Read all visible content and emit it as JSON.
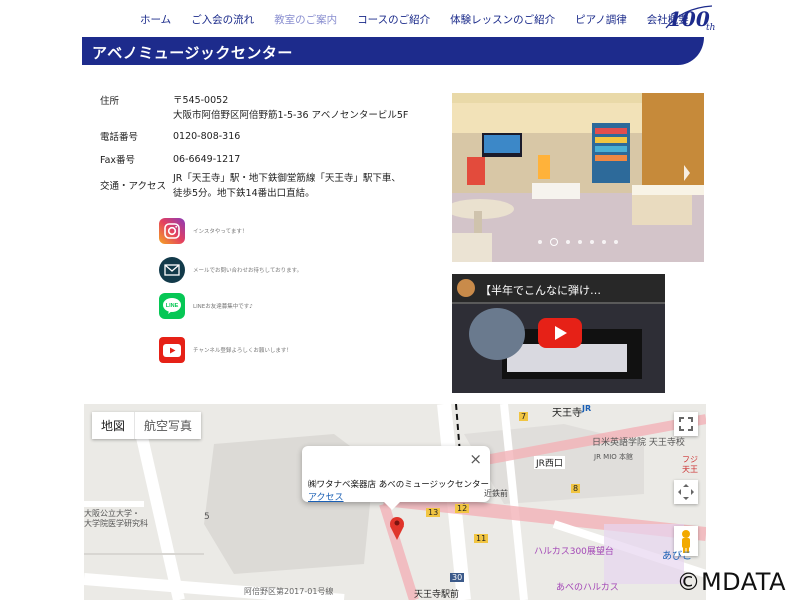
{
  "nav": {
    "items": [
      "ホーム",
      "ご入会の流れ",
      "教室のご案内",
      "コースのご紹介",
      "体験レッスンのご紹介",
      "ピアノ調律",
      "会社概要"
    ],
    "active_index": 2,
    "logo_text": "100th"
  },
  "page_title": "アベノミュージックセンター",
  "info": {
    "address_label": "住所",
    "postal": "〒545-0052",
    "address": "大阪市阿倍野区阿倍野筋1-5-36 アベノセンタービル5F",
    "phone_label": "電話番号",
    "phone": "0120-808-316",
    "fax_label": "Fax番号",
    "fax": "06-6649-1217",
    "access_label": "交通・アクセス",
    "access": "JR「天王寺」駅・地下鉄御堂筋線「天王寺」駅下車、徒歩5分。地下鉄14番出口直結。"
  },
  "social": {
    "instagram": "インスタやってます！",
    "mail": "メールでお問い合わせお待ちしております。",
    "line": "LINEお友達募集中です♪",
    "youtube": "チャンネル登録よろしくお願いします！"
  },
  "carousel": {
    "dots": 8,
    "active": 1
  },
  "video": {
    "title": "【半年でこんなに弾け…"
  },
  "map": {
    "tab_map": "地図",
    "tab_satellite": "航空写真",
    "popup_title": "㈱ワタナベ楽器店 あべのミュージックセンター",
    "popup_link": "アクセス",
    "labels": {
      "tennoji": "天王寺",
      "jr_west": "JR西口",
      "kintetsu": "近鉄前",
      "nichibei": "日米英語学院 天王寺校",
      "jr_mio": "JR MIO 本館",
      "harukas300": "ハルカス300展望台",
      "abeno_harukas": "あべのハルカス",
      "abeno": "あびこ",
      "osaka_univ": "大阪公立大学・",
      "osaka_univ2": "大学院医学研究科",
      "tennoji_ekimae": "天王寺駅前",
      "abeno_ku": "阿倍野区第2017-01号線",
      "fuji": "フジ",
      "fuji2": "天王"
    },
    "markers": [
      "13",
      "12",
      "8",
      "7",
      "5",
      "11",
      "30"
    ]
  },
  "watermark": "©MDATA",
  "colors": {
    "navy": "#1d2b8c",
    "nav_text": "#1a2a8a",
    "active_nav": "#8a8fd0",
    "youtube_red": "#e62117",
    "line_green": "#06c755"
  }
}
